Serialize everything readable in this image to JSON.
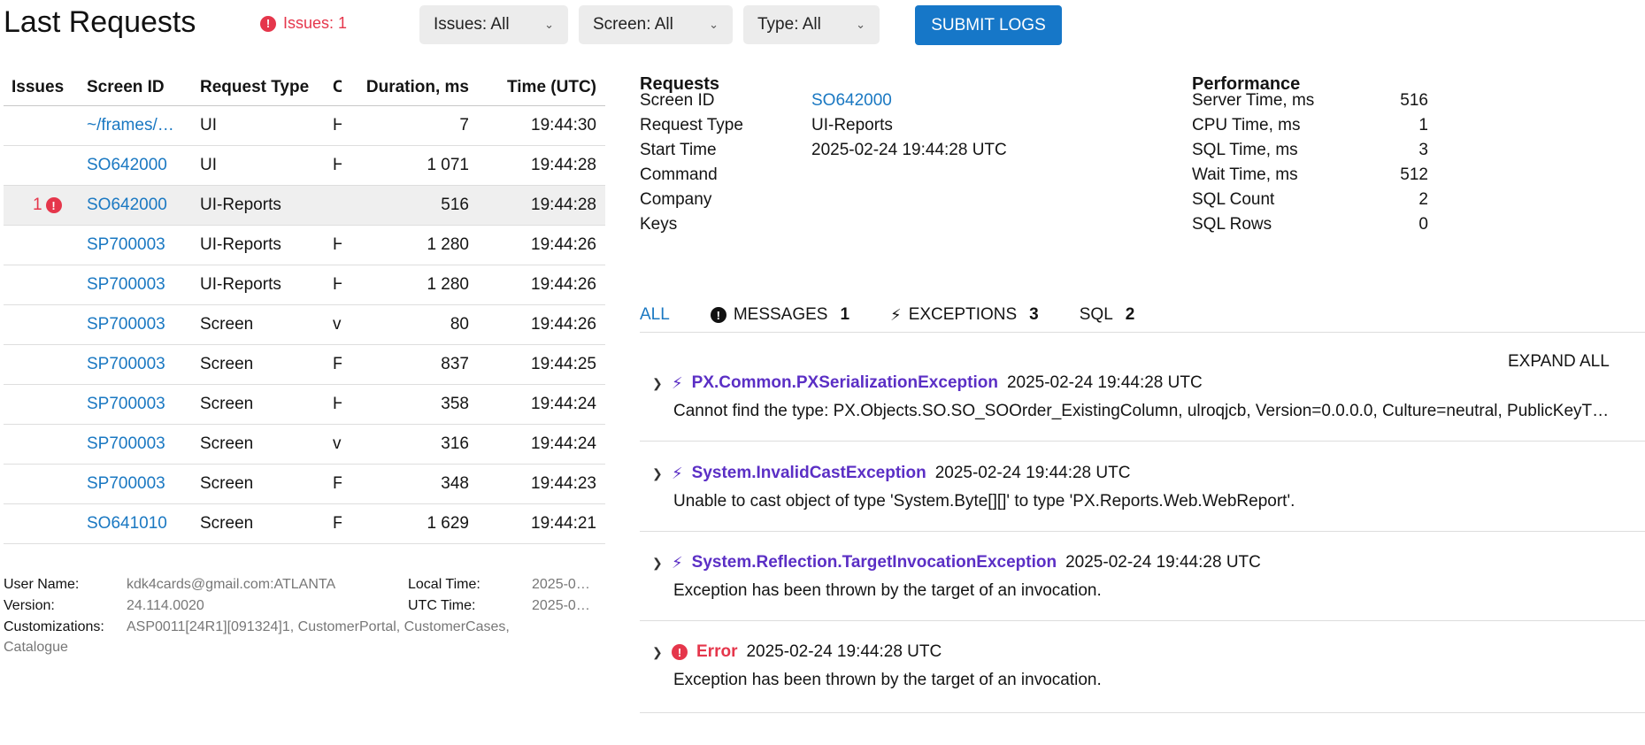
{
  "header": {
    "title": "Last Requests",
    "issues_badge": "Issues: 1",
    "filters": [
      {
        "label": "Issues: All"
      },
      {
        "label": "Screen: All"
      },
      {
        "label": "Type: All"
      }
    ],
    "submit_label": "SUBMIT LOGS"
  },
  "table": {
    "columns": [
      "Issues",
      "Screen ID",
      "Request Type",
      "C",
      "Duration, ms",
      "Time (UTC)"
    ],
    "rows": [
      {
        "issues": "",
        "screen_id": "~/frames/…",
        "request_type": "UI",
        "c": "H",
        "duration": "7",
        "time": "19:44:30"
      },
      {
        "issues": "",
        "screen_id": "SO642000",
        "request_type": "UI",
        "c": "H",
        "duration": "1 071",
        "time": "19:44:28"
      },
      {
        "issues": "1",
        "screen_id": "SO642000",
        "request_type": "UI-Reports",
        "c": "",
        "duration": "516",
        "time": "19:44:28"
      },
      {
        "issues": "",
        "screen_id": "SP700003",
        "request_type": "UI-Reports",
        "c": "H",
        "duration": "1 280",
        "time": "19:44:26"
      },
      {
        "issues": "",
        "screen_id": "SP700003",
        "request_type": "UI-Reports",
        "c": "H",
        "duration": "1 280",
        "time": "19:44:26"
      },
      {
        "issues": "",
        "screen_id": "SP700003",
        "request_type": "Screen",
        "c": "v",
        "duration": "80",
        "time": "19:44:26"
      },
      {
        "issues": "",
        "screen_id": "SP700003",
        "request_type": "Screen",
        "c": "F",
        "duration": "837",
        "time": "19:44:25"
      },
      {
        "issues": "",
        "screen_id": "SP700003",
        "request_type": "Screen",
        "c": "H",
        "duration": "358",
        "time": "19:44:24"
      },
      {
        "issues": "",
        "screen_id": "SP700003",
        "request_type": "Screen",
        "c": "v",
        "duration": "316",
        "time": "19:44:24"
      },
      {
        "issues": "",
        "screen_id": "SP700003",
        "request_type": "Screen",
        "c": "F",
        "duration": "348",
        "time": "19:44:23"
      },
      {
        "issues": "",
        "screen_id": "SO641010",
        "request_type": "Screen",
        "c": "F",
        "duration": "1 629",
        "time": "19:44:21"
      }
    ]
  },
  "footer": {
    "user_name_label": "User Name:",
    "user_name": "kdk4cards@gmail.com:ATLANTA",
    "version_label": "Version:",
    "version": "24.114.0020",
    "customizations_label": "Customizations:",
    "customizations": "ASP0011[24R1][091324]1, CustomerPortal, CustomerCases,",
    "customizations_cont": "Catalogue",
    "local_time_label": "Local Time:",
    "local_time": "2025-0…",
    "utc_time_label": "UTC Time:",
    "utc_time": "2025-0…"
  },
  "requests": {
    "heading": "Requests",
    "fields": [
      {
        "label": "Screen ID",
        "value": "SO642000"
      },
      {
        "label": "Request Type",
        "value": "UI-Reports"
      },
      {
        "label": "Start Time",
        "value": "2025-02-24 19:44:28 UTC"
      },
      {
        "label": "Command",
        "value": ""
      },
      {
        "label": "Company",
        "value": ""
      },
      {
        "label": "Keys",
        "value": ""
      }
    ]
  },
  "performance": {
    "heading": "Performance",
    "fields": [
      {
        "label": "Server Time, ms",
        "value": "516"
      },
      {
        "label": "CPU Time, ms",
        "value": "1"
      },
      {
        "label": "SQL Time, ms",
        "value": "3"
      },
      {
        "label": "Wait Time, ms",
        "value": "512"
      },
      {
        "label": "SQL Count",
        "value": "2"
      },
      {
        "label": "SQL Rows",
        "value": "0"
      }
    ]
  },
  "tabs": [
    {
      "label": "ALL",
      "count": ""
    },
    {
      "label": "MESSAGES",
      "count": "1"
    },
    {
      "label": "EXCEPTIONS",
      "count": "3"
    },
    {
      "label": "SQL",
      "count": "2"
    }
  ],
  "expand_all": "EXPAND ALL",
  "events": [
    {
      "kind": "exception",
      "name": "PX.Common.PXSerializationException",
      "time": "2025-02-24 19:44:28 UTC",
      "message": "Cannot find the type: PX.Objects.SO.SO_SOOrder_ExistingColumn, ulroqjcb, Version=0.0.0.0, Culture=neutral, PublicKeyT…"
    },
    {
      "kind": "exception",
      "name": "System.InvalidCastException",
      "time": "2025-02-24 19:44:28 UTC",
      "message": "Unable to cast object of type 'System.Byte[][]' to type 'PX.Reports.Web.WebReport'."
    },
    {
      "kind": "exception",
      "name": "System.Reflection.TargetInvocationException",
      "time": "2025-02-24 19:44:28 UTC",
      "message": "Exception has been thrown by the target of an invocation."
    },
    {
      "kind": "error",
      "name": "Error",
      "time": "2025-02-24 19:44:28 UTC",
      "message": "Exception has been thrown by the target of an invocation."
    }
  ],
  "colors": {
    "accent": "#1677c8",
    "error": "#e5364b",
    "exception": "#5b2fc5"
  }
}
